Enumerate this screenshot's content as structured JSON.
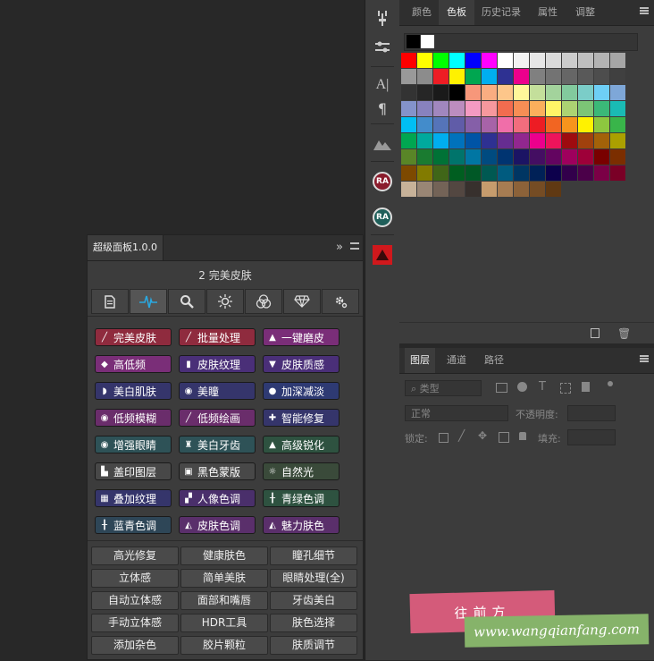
{
  "toolstrip": {
    "icons": [
      "adjust-icon",
      "sliders-icon",
      "type-icon",
      "paragraph-icon",
      "mountain-icon",
      "ra-red-icon",
      "ra-teal-icon",
      "red-warning-icon"
    ],
    "ra_label": "RA",
    "type_glyph": "A|",
    "para_glyph": "¶"
  },
  "color_panel": {
    "tabs": [
      "颜色",
      "色板",
      "历史记录",
      "属性",
      "调整"
    ],
    "active_tab": "色板",
    "recent": [
      "#000000",
      "#ffffff"
    ],
    "swatches": [
      [
        "#ff0000",
        "#ffff00",
        "#00ff00",
        "#00ffff",
        "#0000ff",
        "#ff00ff",
        "#ffffff",
        "#f2f2f2",
        "#e6e6e6",
        "#d9d9d9",
        "#cccccc",
        "#bfbfbf",
        "#b3b3b3",
        "#a6a6a6"
      ],
      [
        "#999999",
        "#8c8c8c",
        "#ee1d24",
        "#fff100",
        "#00a650",
        "#00aeef",
        "#2e3192",
        "#ec008c",
        "#808080",
        "#737373",
        "#666666",
        "#595959",
        "#4d4d4d",
        "#404040"
      ],
      [
        "#333333",
        "#262626",
        "#1a1a1a",
        "#000000",
        "#f7977a",
        "#f9ad81",
        "#fdc68a",
        "#fff79a",
        "#c4df9b",
        "#a3d39c",
        "#82ca9d",
        "#7bcdc8",
        "#6ecff6",
        "#7ea7d8"
      ],
      [
        "#8493ca",
        "#8882be",
        "#a187be",
        "#bc8dbf",
        "#f49ac2",
        "#f6989d",
        "#f26c4f",
        "#f68e55",
        "#fbaf5c",
        "#fff467",
        "#acd372",
        "#7cc576",
        "#3bb878",
        "#1abbb4"
      ],
      [
        "#00bff3",
        "#438ccb",
        "#5574b9",
        "#605ca8",
        "#855fa8",
        "#a763a8",
        "#f06ea9",
        "#f26d7d",
        "#ed1c24",
        "#f26522",
        "#f7941d",
        "#fff200",
        "#8dc73f",
        "#39b54a"
      ],
      [
        "#00a651",
        "#00a99d",
        "#00aeef",
        "#0072bc",
        "#0054a6",
        "#2e3192",
        "#662d91",
        "#92278f",
        "#ec008c",
        "#ed145b",
        "#9e0b0f",
        "#a0410d",
        "#a36209",
        "#aba000"
      ],
      [
        "#598527",
        "#1a7b30",
        "#007236",
        "#00746b",
        "#0076a3",
        "#004b80",
        "#003471",
        "#1b1464",
        "#440e62",
        "#630460",
        "#9e005d",
        "#9e0039",
        "#790000",
        "#7b2e00"
      ],
      [
        "#7d4900",
        "#827b00",
        "#406618",
        "#005e20",
        "#005826",
        "#005952",
        "#005b7f",
        "#003663",
        "#002157",
        "#0d004c",
        "#32004b",
        "#4b0049",
        "#7b0046",
        "#7a0026"
      ],
      [
        "#c7b299",
        "#998675",
        "#736357",
        "#534741",
        "#37302d",
        "#c69c6d",
        "#a67c52",
        "#8c6239",
        "#754c24",
        "#603913"
      ]
    ],
    "bottom_icons": [
      "new-swatch-icon",
      "trash-icon"
    ]
  },
  "layers_panel": {
    "tabs": [
      "图层",
      "通道",
      "路径"
    ],
    "active_tab": "图层",
    "filter_label": "类型",
    "blend_mode": "正常",
    "opacity_label": "不透明度:",
    "lock_label": "锁定:",
    "fill_label": "填充:"
  },
  "super_panel": {
    "tab_label": "超级面板1.0.0",
    "collapse_glyph": "»",
    "subtitle": "2 完美皮肤",
    "icon_tabs": [
      "document-icon",
      "pulse-icon",
      "search-icon",
      "sun-icon",
      "circles-icon",
      "diamond-icon",
      "gear-icon"
    ],
    "colored_buttons": [
      [
        {
          "label": "完美皮肤",
          "color": "#8f2b3e",
          "glyph": "╱"
        },
        {
          "label": "批量处理",
          "color": "#8f2b3e",
          "glyph": "╱"
        },
        {
          "label": "一键磨皮",
          "color": "#7a2e78",
          "glyph": "▲"
        }
      ],
      [
        {
          "label": "高低频",
          "color": "#7a2e78",
          "glyph": "◆"
        },
        {
          "label": "皮肤纹理",
          "color": "#4a2f78",
          "glyph": "▮"
        },
        {
          "label": "皮肤质感",
          "color": "#4a2f78",
          "glyph": "▼"
        }
      ],
      [
        {
          "label": "美白肌肤",
          "color": "#35356b",
          "glyph": "◗"
        },
        {
          "label": "美瞳",
          "color": "#35356b",
          "glyph": "◉"
        },
        {
          "label": "加深减淡",
          "color": "#2e3a73",
          "glyph": "●"
        }
      ],
      [
        {
          "label": "低频模糊",
          "color": "#6a2d6b",
          "glyph": "◉"
        },
        {
          "label": "低频绘画",
          "color": "#6a2d6b",
          "glyph": "╱"
        },
        {
          "label": "智能修复",
          "color": "#35356b",
          "glyph": "✚"
        }
      ],
      [
        {
          "label": "增强眼睛",
          "color": "#2e5257",
          "glyph": "◉"
        },
        {
          "label": "美白牙齿",
          "color": "#2e5257",
          "glyph": "♜"
        },
        {
          "label": "高级锐化",
          "color": "#2e5240",
          "glyph": "▲"
        }
      ],
      [
        {
          "label": "盖印图层",
          "color": "#484848",
          "glyph": "▙"
        },
        {
          "label": "黑色蒙版",
          "color": "#484848",
          "glyph": "▣"
        },
        {
          "label": "自然光",
          "color": "#3a4a3a",
          "glyph": "☼"
        }
      ],
      [
        {
          "label": "叠加纹理",
          "color": "#35356b",
          "glyph": "▦"
        },
        {
          "label": "人像色调",
          "color": "#4a2f6b",
          "glyph": "▞"
        },
        {
          "label": "青绿色调",
          "color": "#2e5240",
          "glyph": "╂"
        }
      ],
      [
        {
          "label": "蓝青色调",
          "color": "#2e4657",
          "glyph": "╂"
        },
        {
          "label": "皮肤色调",
          "color": "#5a2f6b",
          "glyph": "◭"
        },
        {
          "label": "魅力肤色",
          "color": "#5a2f6b",
          "glyph": "◭"
        }
      ]
    ],
    "gray_buttons": [
      [
        "高光修复",
        "健康肤色",
        "瞳孔细节"
      ],
      [
        "立体感",
        "简单美肤",
        "眼睛处理(全)"
      ],
      [
        "自动立体感",
        "面部和嘴唇",
        "牙齿美白"
      ],
      [
        "手动立体感",
        "HDR工具",
        "肤色选择"
      ],
      [
        "添加杂色",
        "胶片颗粒",
        "肤质调节"
      ]
    ]
  },
  "watermark": {
    "stamp_text": "往前方",
    "url_text": "www.wangqianfang.com"
  }
}
